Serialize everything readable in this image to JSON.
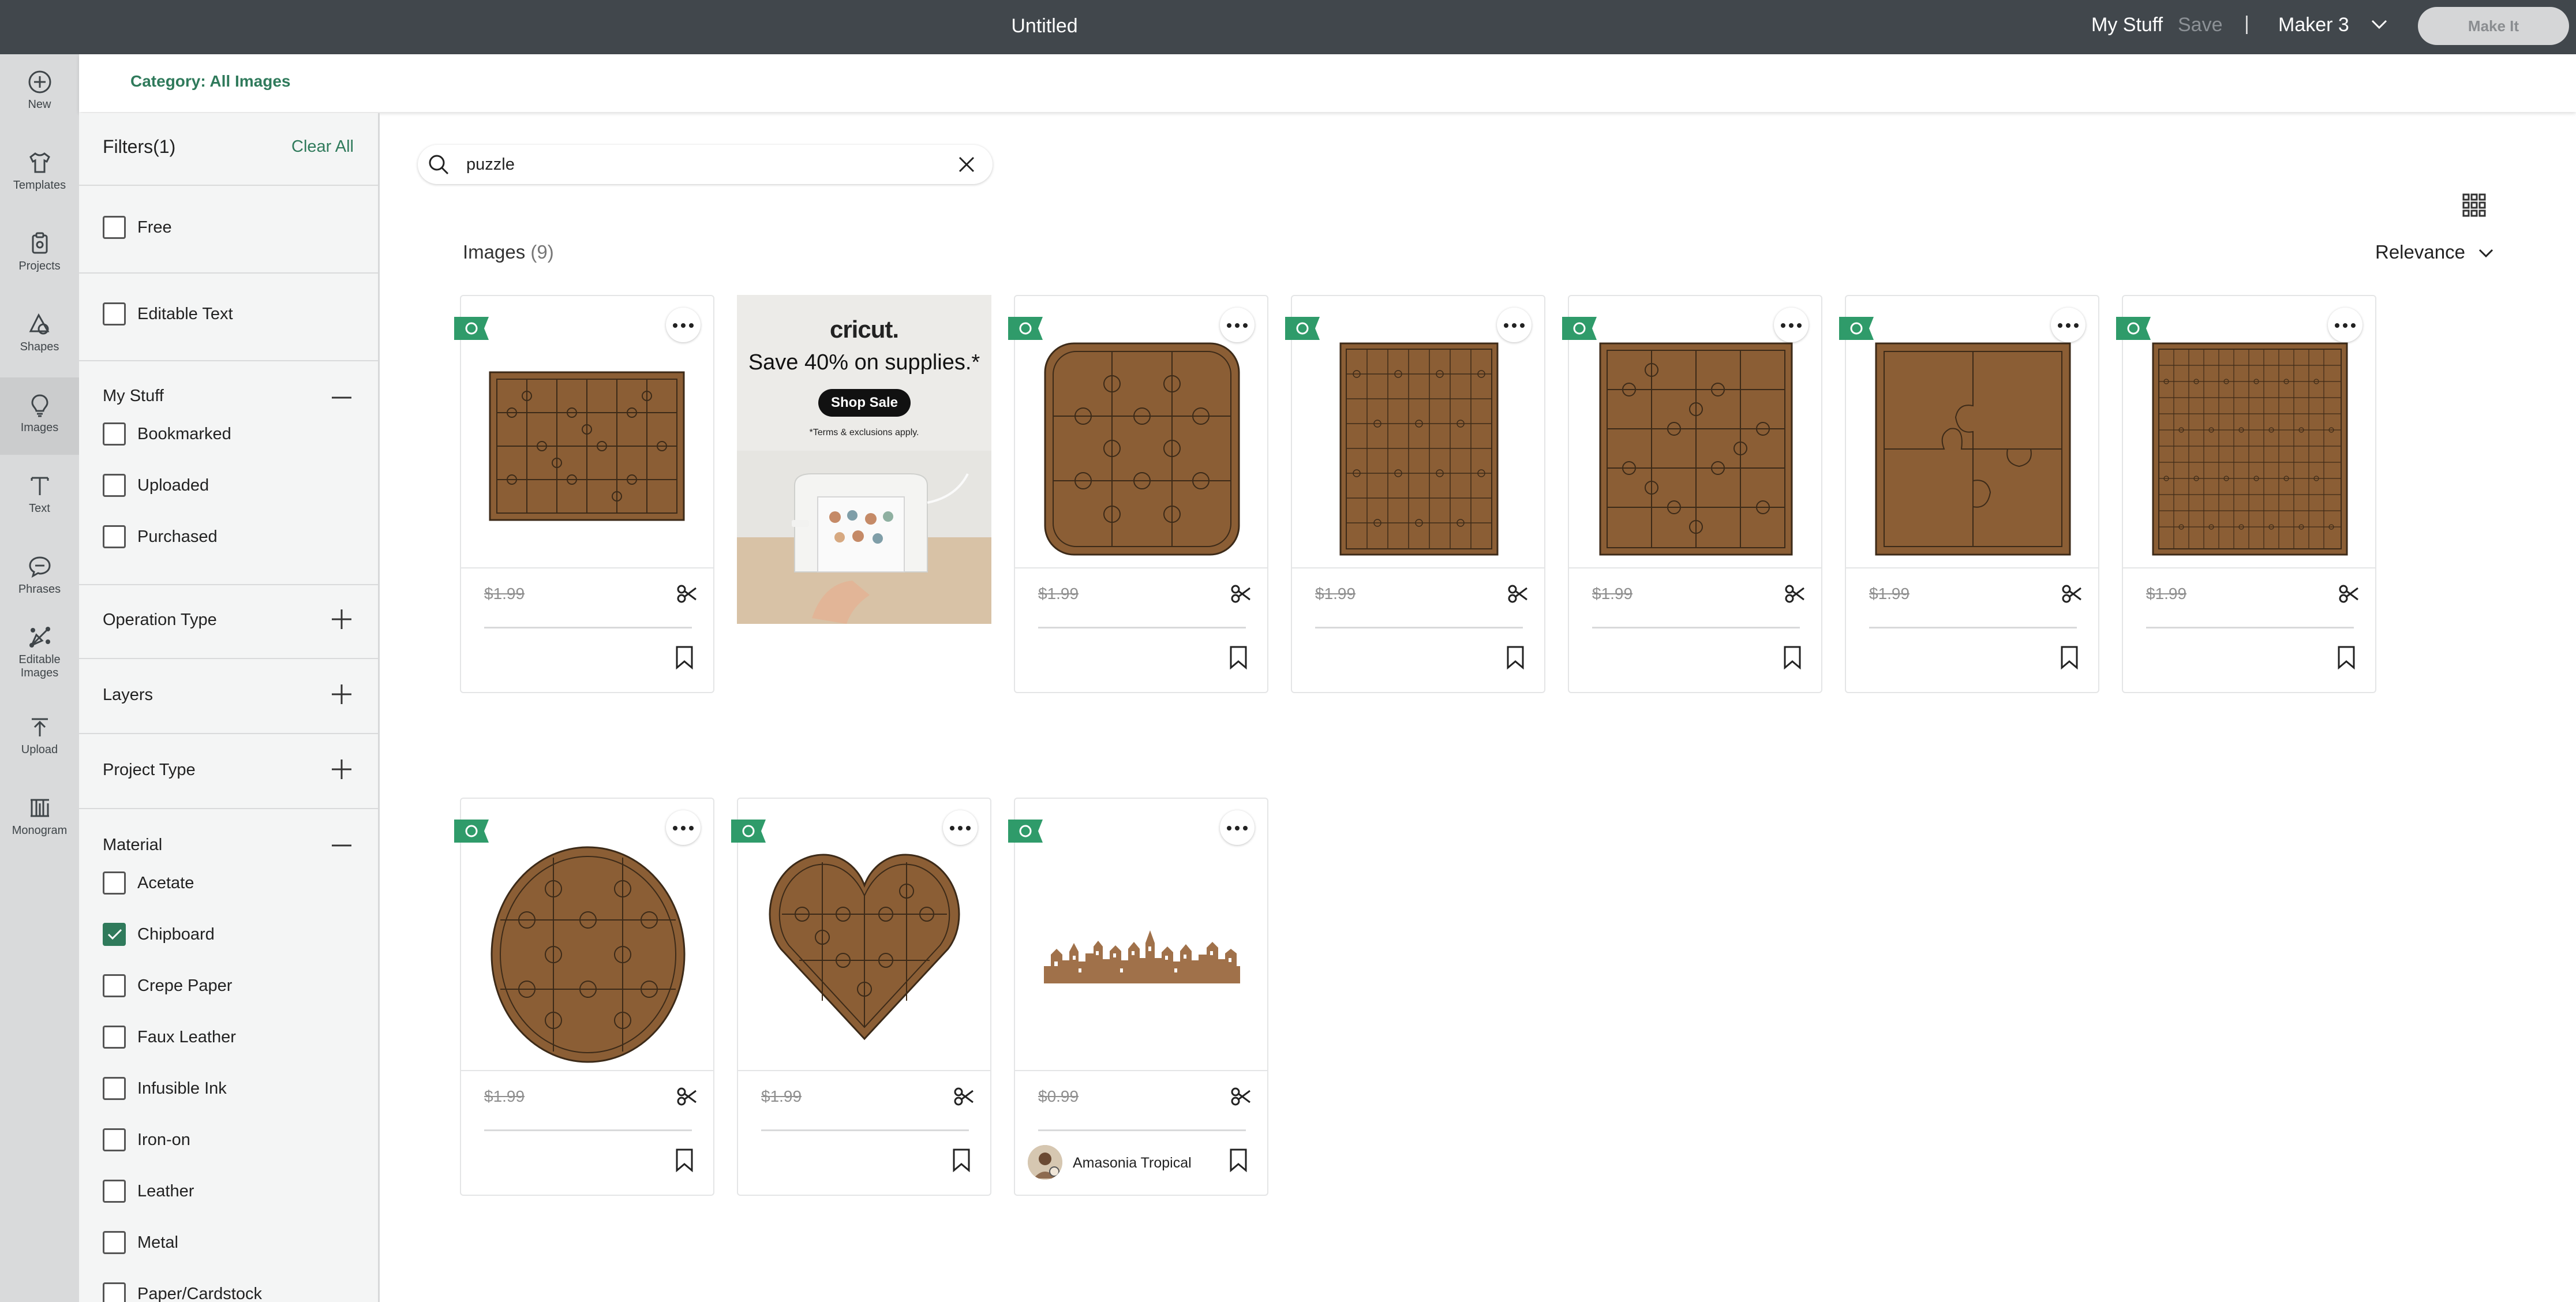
{
  "topbar": {
    "title": "Untitled",
    "my_stuff": "My Stuff",
    "save": "Save",
    "separator": "|",
    "machine": "Maker 3",
    "make_it": "Make It"
  },
  "rail": [
    {
      "label": "New",
      "icon": "plus-circle-icon"
    },
    {
      "label": "Templates",
      "icon": "shirt-icon"
    },
    {
      "label": "Projects",
      "icon": "clipboard-icon"
    },
    {
      "label": "Shapes",
      "icon": "shapes-icon"
    },
    {
      "label": "Images",
      "icon": "lightbulb-icon"
    },
    {
      "label": "Text",
      "icon": "text-icon"
    },
    {
      "label": "Phrases",
      "icon": "speech-bubble-icon"
    },
    {
      "label": "Editable",
      "label2": "Images",
      "icon": "editable-images-icon"
    },
    {
      "label": "Upload",
      "icon": "upload-icon"
    },
    {
      "label": "Monogram",
      "icon": "monogram-icon"
    }
  ],
  "category": "Category: All Images",
  "filters": {
    "title": "Filters(1)",
    "clear_all": "Clear All",
    "free": "Free",
    "editable_text": "Editable Text",
    "my_stuff": {
      "title": "My Stuff",
      "options": [
        "Bookmarked",
        "Uploaded",
        "Purchased"
      ]
    },
    "operation_type": "Operation Type",
    "layers": "Layers",
    "project_type": "Project Type",
    "material": {
      "title": "Material",
      "options": [
        "Acetate",
        "Chipboard",
        "Crepe Paper",
        "Faux Leather",
        "Infusible Ink",
        "Iron-on",
        "Leather",
        "Metal",
        "Paper/Cardstock"
      ],
      "checked": "Chipboard"
    }
  },
  "search": {
    "value": "puzzle",
    "icon": "search-icon"
  },
  "results": {
    "label": "Images",
    "count": "(9)",
    "sort": "Relevance"
  },
  "ad": {
    "logo": "cricut.",
    "headline": "Save 40% on supplies.*",
    "button": "Shop Sale",
    "terms": "*Terms & exclusions apply."
  },
  "cards": [
    {
      "price": "$1.99",
      "art": "rect-puzzle-landscape"
    },
    {
      "price": "$1.99",
      "art": "rounded-puzzle-3x3"
    },
    {
      "price": "$1.99",
      "art": "puzzle-tall-fine"
    },
    {
      "price": "$1.99",
      "art": "puzzle-tall-medium"
    },
    {
      "price": "$1.99",
      "art": "puzzle-4-piece"
    },
    {
      "price": "$1.99",
      "art": "puzzle-tall-very-fine"
    },
    {
      "price": "$1.99",
      "art": "oval-puzzle"
    },
    {
      "price": "$1.99",
      "art": "heart-puzzle"
    },
    {
      "price": "$0.99",
      "art": "village-skyline",
      "author": "Amasonia Tropical"
    }
  ],
  "colors": {
    "accent": "#2f7a5b",
    "puzzle": "#8b5e35",
    "topbar": "#41474c"
  }
}
